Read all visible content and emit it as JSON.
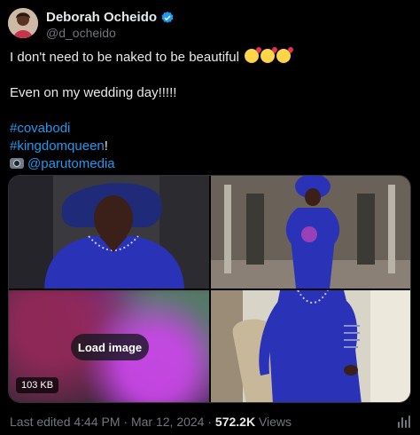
{
  "author": {
    "name": "Deborah Ocheido",
    "handle": "@d_ocheido",
    "avatar_icon": "avatar-photo",
    "verified_color": "#1d9bf0"
  },
  "tweet": {
    "line1": "I don't need to be naked to be beautiful",
    "line1_emoji_count": 3,
    "line2": "Even on my wedding day!!!!!",
    "hashtag1": "#covabodi",
    "hashtag2": "#kingdomqueen",
    "hashtag2_suffix": "!",
    "camera_icon": "camera-flash-icon",
    "mention": "@parutomedia"
  },
  "media": {
    "load_label": "Load image",
    "size_label": "103 KB"
  },
  "meta": {
    "edited": "Last edited 4:44 PM · Mar 12, 2024 · ",
    "views_count": "572.2K",
    "views_label": " Views"
  },
  "colors": {
    "link": "#1d9bf0",
    "secondary": "#71767b",
    "dress_blue": "#2a32b8"
  }
}
